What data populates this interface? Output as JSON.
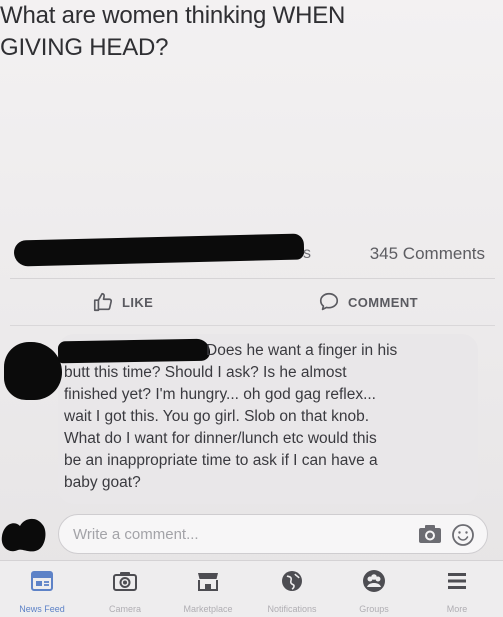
{
  "post": {
    "text_line_1": "What are women thinking WHEN",
    "text_line_2": "GIVING HEAD?"
  },
  "stats": {
    "reactions_suffix": "s",
    "comments_count": "345 Comments"
  },
  "actions": {
    "like_label": "LIKE",
    "comment_label": "COMMENT"
  },
  "comment": {
    "line_1": "Does he want a finger in his",
    "line_2": "butt this time? Should I ask? Is he almost",
    "line_3": "finished yet? I'm hungry... oh god gag reflex...",
    "line_4": "wait I got this. You go girl. Slob on that knob.",
    "line_5": "What do I want for dinner/lunch etc would this",
    "line_6": "be an inappropriate time to ask if I can have a",
    "line_7": "baby goat?"
  },
  "composer": {
    "placeholder": "Write a comment..."
  },
  "tabbar": {
    "items": [
      {
        "label": "News Feed",
        "icon": "news-feed-icon",
        "active": true
      },
      {
        "label": "Camera",
        "icon": "camera-icon",
        "active": false
      },
      {
        "label": "Marketplace",
        "icon": "marketplace-icon",
        "active": false
      },
      {
        "label": "Notifications",
        "icon": "globe-icon",
        "active": false
      },
      {
        "label": "Groups",
        "icon": "groups-icon",
        "active": false
      },
      {
        "label": "More",
        "icon": "menu-icon",
        "active": false
      }
    ]
  },
  "colors": {
    "accent": "#5d82c7",
    "text": "#2f2f33",
    "muted": "#b0aeb3",
    "redaction": "#0b0b0b"
  }
}
